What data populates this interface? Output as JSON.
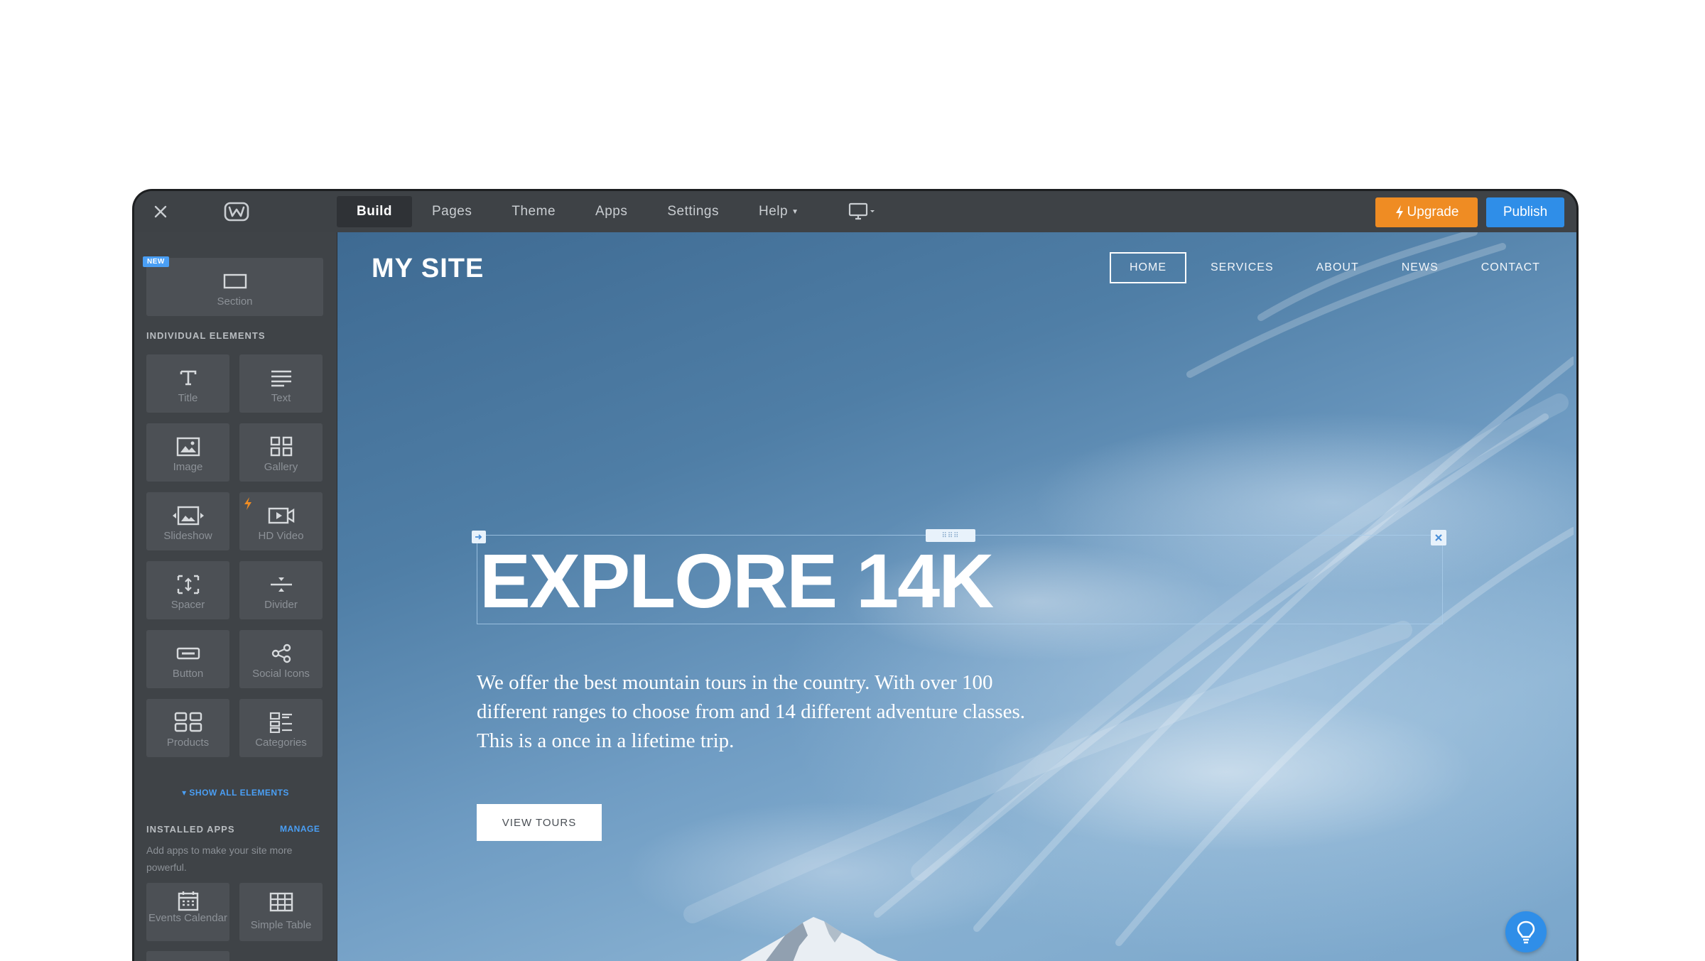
{
  "topbar": {
    "close_icon": "close-icon",
    "logo_icon": "weebly-logo-icon",
    "tabs": [
      {
        "label": "Build",
        "active": true
      },
      {
        "label": "Pages",
        "active": false
      },
      {
        "label": "Theme",
        "active": false
      },
      {
        "label": "Apps",
        "active": false
      },
      {
        "label": "Settings",
        "active": false
      },
      {
        "label": "Help",
        "active": false
      }
    ],
    "device_icon": "desktop-monitor-icon",
    "upgrade_label": "Upgrade",
    "publish_label": "Publish",
    "colors": {
      "upgrade": "#ef8c23",
      "publish": "#2f8ee8",
      "bar": "#3e4246"
    }
  },
  "sidebar": {
    "new_badge": "NEW",
    "section_label": "Section",
    "individual_elements_heading": "INDIVIDUAL ELEMENTS",
    "elements": [
      {
        "label": "Title",
        "icon": "title-icon"
      },
      {
        "label": "Text",
        "icon": "text-icon"
      },
      {
        "label": "Image",
        "icon": "image-icon"
      },
      {
        "label": "Gallery",
        "icon": "gallery-icon"
      },
      {
        "label": "Slideshow",
        "icon": "slideshow-icon"
      },
      {
        "label": "HD Video",
        "icon": "hd-video-icon"
      },
      {
        "label": "Spacer",
        "icon": "spacer-icon"
      },
      {
        "label": "Divider",
        "icon": "divider-icon"
      },
      {
        "label": "Button",
        "icon": "button-icon"
      },
      {
        "label": "Social Icons",
        "icon": "share-icon"
      },
      {
        "label": "Products",
        "icon": "products-icon"
      },
      {
        "label": "Categories",
        "icon": "categories-icon"
      }
    ],
    "show_all_label": "SHOW ALL ELEMENTS",
    "installed_apps_heading": "INSTALLED APPS",
    "manage_label": "MANAGE",
    "apps_description": "Add apps to make your site more powerful.",
    "apps": [
      {
        "label": "Events Calendar",
        "icon": "calendar-icon"
      },
      {
        "label": "Simple Table",
        "icon": "table-icon"
      }
    ],
    "add_icon": "plus-icon"
  },
  "site": {
    "title": "MY SITE",
    "nav": [
      {
        "label": "HOME",
        "active": true
      },
      {
        "label": "SERVICES",
        "active": false
      },
      {
        "label": "ABOUT",
        "active": false
      },
      {
        "label": "NEWS",
        "active": false
      },
      {
        "label": "CONTACT",
        "active": false
      }
    ],
    "headline": "EXPLORE 14K",
    "subtext": "We offer the best mountain tours in the country. With over 100 different ranges to choose from and 14 different adventure classes. This is a once in a lifetime trip.",
    "cta_label": "VIEW TOURS",
    "help_icon": "lightbulb-icon"
  }
}
